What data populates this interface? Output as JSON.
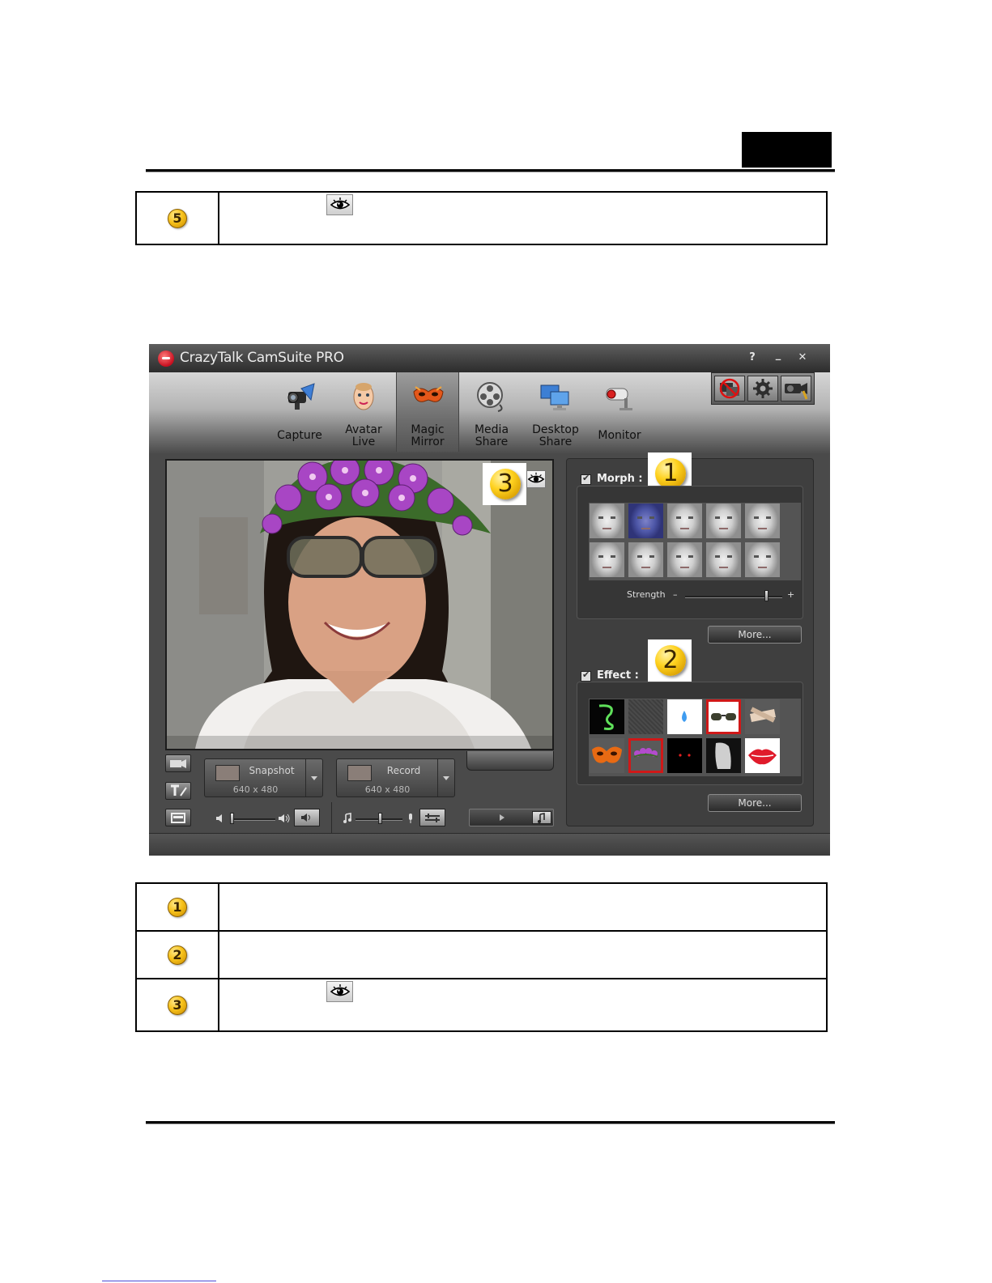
{
  "callout_top": {
    "number": "5"
  },
  "app": {
    "title": "CrazyTalk CamSuite PRO",
    "controls": {
      "help": "?",
      "minimize": "_",
      "close": "✕"
    },
    "nav": [
      {
        "label": "Capture",
        "icon": "camera-icon"
      },
      {
        "label": "Avatar\nLive",
        "icon": "baby-face-icon"
      },
      {
        "label": "Magic\nMirror",
        "icon": "mask-icon",
        "active": true
      },
      {
        "label": "Media\nShare",
        "icon": "film-reel-icon"
      },
      {
        "label": "Desktop\nShare",
        "icon": "monitors-icon"
      },
      {
        "label": "Monitor",
        "icon": "security-camera-icon"
      }
    ],
    "preview_badge": "3",
    "snapshot": {
      "label": "Snapshot",
      "resolution": "640 x 480"
    },
    "record": {
      "label": "Record",
      "resolution": "640 x 480"
    },
    "morph": {
      "label": "Morph :",
      "badge": "1",
      "checked": true,
      "strength_label": "Strength",
      "strength_minus": "–",
      "strength_plus": "+",
      "strength_value": 0.83,
      "more": "More..."
    },
    "effect": {
      "label": "Effect :",
      "badge": "2",
      "checked": true,
      "more": "More..."
    }
  },
  "callouts_bottom": [
    {
      "number": "1"
    },
    {
      "number": "2"
    },
    {
      "number": "3"
    }
  ]
}
